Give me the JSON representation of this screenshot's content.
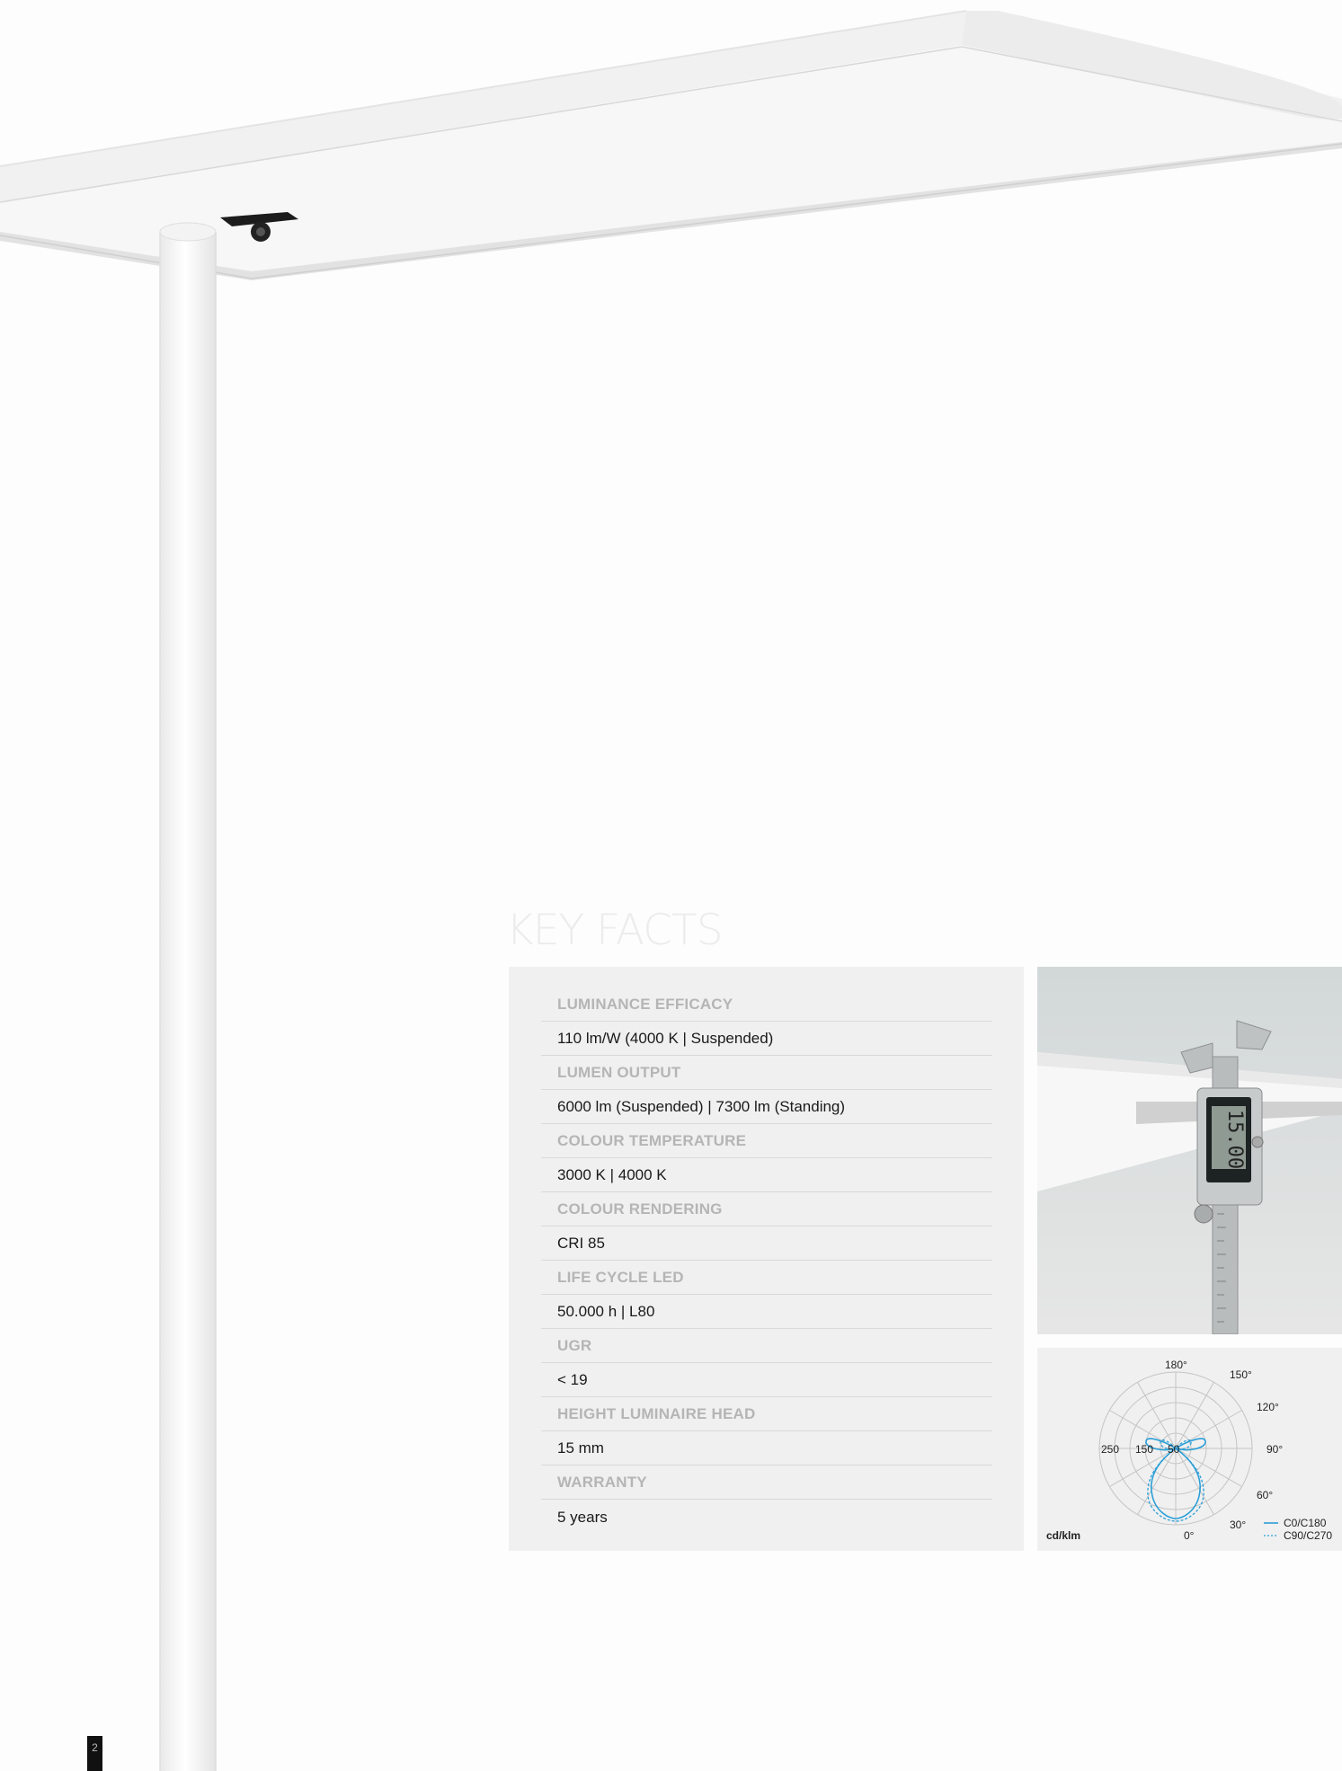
{
  "section": {
    "title": "KEY FACTS"
  },
  "facts": [
    {
      "label": "LUMINANCE EFFICACY",
      "value": "110 lm/W (4000 K | Suspended)"
    },
    {
      "label": "LUMEN OUTPUT",
      "value": "6000 lm (Suspended) | 7300 lm (Standing)"
    },
    {
      "label": "COLOUR TEMPERATURE",
      "value": "3000 K | 4000 K"
    },
    {
      "label": "COLOUR RENDERING",
      "value": "CRI 85"
    },
    {
      "label": "LIFE CYCLE LED",
      "value": "50.000 h | L80"
    },
    {
      "label": "UGR",
      "value": "< 19"
    },
    {
      "label": "HEIGHT LUMINAIRE HEAD",
      "value": "15 mm"
    },
    {
      "label": "WARRANTY",
      "value": "5 years"
    }
  ],
  "caliper_display": "15.00",
  "polar": {
    "unit": "cd/klm",
    "radial_labels": [
      "250",
      "150",
      "50"
    ],
    "angle_labels": [
      "180°",
      "150°",
      "120°",
      "90°",
      "60°",
      "30°",
      "0°"
    ],
    "legend": [
      "C0/C180",
      "C90/C270"
    ],
    "line_color": "#2a9fd8"
  },
  "page_number": "2"
}
